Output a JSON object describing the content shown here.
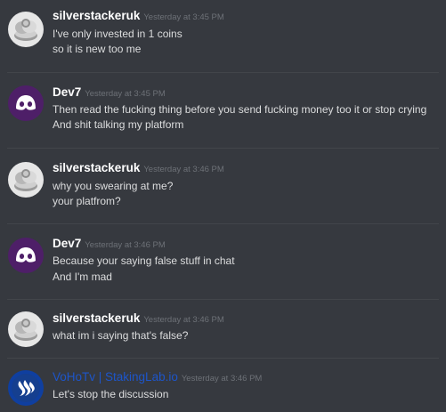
{
  "messages": [
    {
      "author": "silverstackeruk",
      "timestamp": "Yesterday at 3:45 PM",
      "avatar_icon": "silver-coin-stack-avatar-icon",
      "lines": [
        "I've only invested in 1 coins",
        "so it is new too me"
      ]
    },
    {
      "author": "Dev7",
      "timestamp": "Yesterday at 3:45 PM",
      "avatar_icon": "discord-default-avatar-icon",
      "lines": [
        "Then read the fucking thing before you send fucking money too it or stop crying",
        "And shit talking my platform"
      ]
    },
    {
      "author": "silverstackeruk",
      "timestamp": "Yesterday at 3:46 PM",
      "avatar_icon": "silver-coin-stack-avatar-icon",
      "lines": [
        "why you swearing at me?",
        "your platfrom?"
      ]
    },
    {
      "author": "Dev7",
      "timestamp": "Yesterday at 3:46 PM",
      "avatar_icon": "discord-default-avatar-icon",
      "lines": [
        "Because your saying false stuff in chat",
        "And I'm mad"
      ]
    },
    {
      "author": "silverstackeruk",
      "timestamp": "Yesterday at 3:46 PM",
      "avatar_icon": "silver-coin-stack-avatar-icon",
      "lines": [
        "what im i saying that's false?"
      ]
    },
    {
      "author": "VoHoTv | StakingLab.io",
      "timestamp": "Yesterday at 3:46 PM",
      "avatar_icon": "steem-logo-avatar-icon",
      "lines": [
        "Let's stop the discussion"
      ]
    }
  ],
  "colors": {
    "background": "#36393f",
    "divider": "#42454a",
    "username": "#ffffff",
    "username_highlight": "#1d55c9",
    "message_text": "#dcddde",
    "timestamp": "#6d7177",
    "dev7_avatar_bg": "#4e1f68",
    "steem_avatar_bg": "#0f3fa0"
  }
}
